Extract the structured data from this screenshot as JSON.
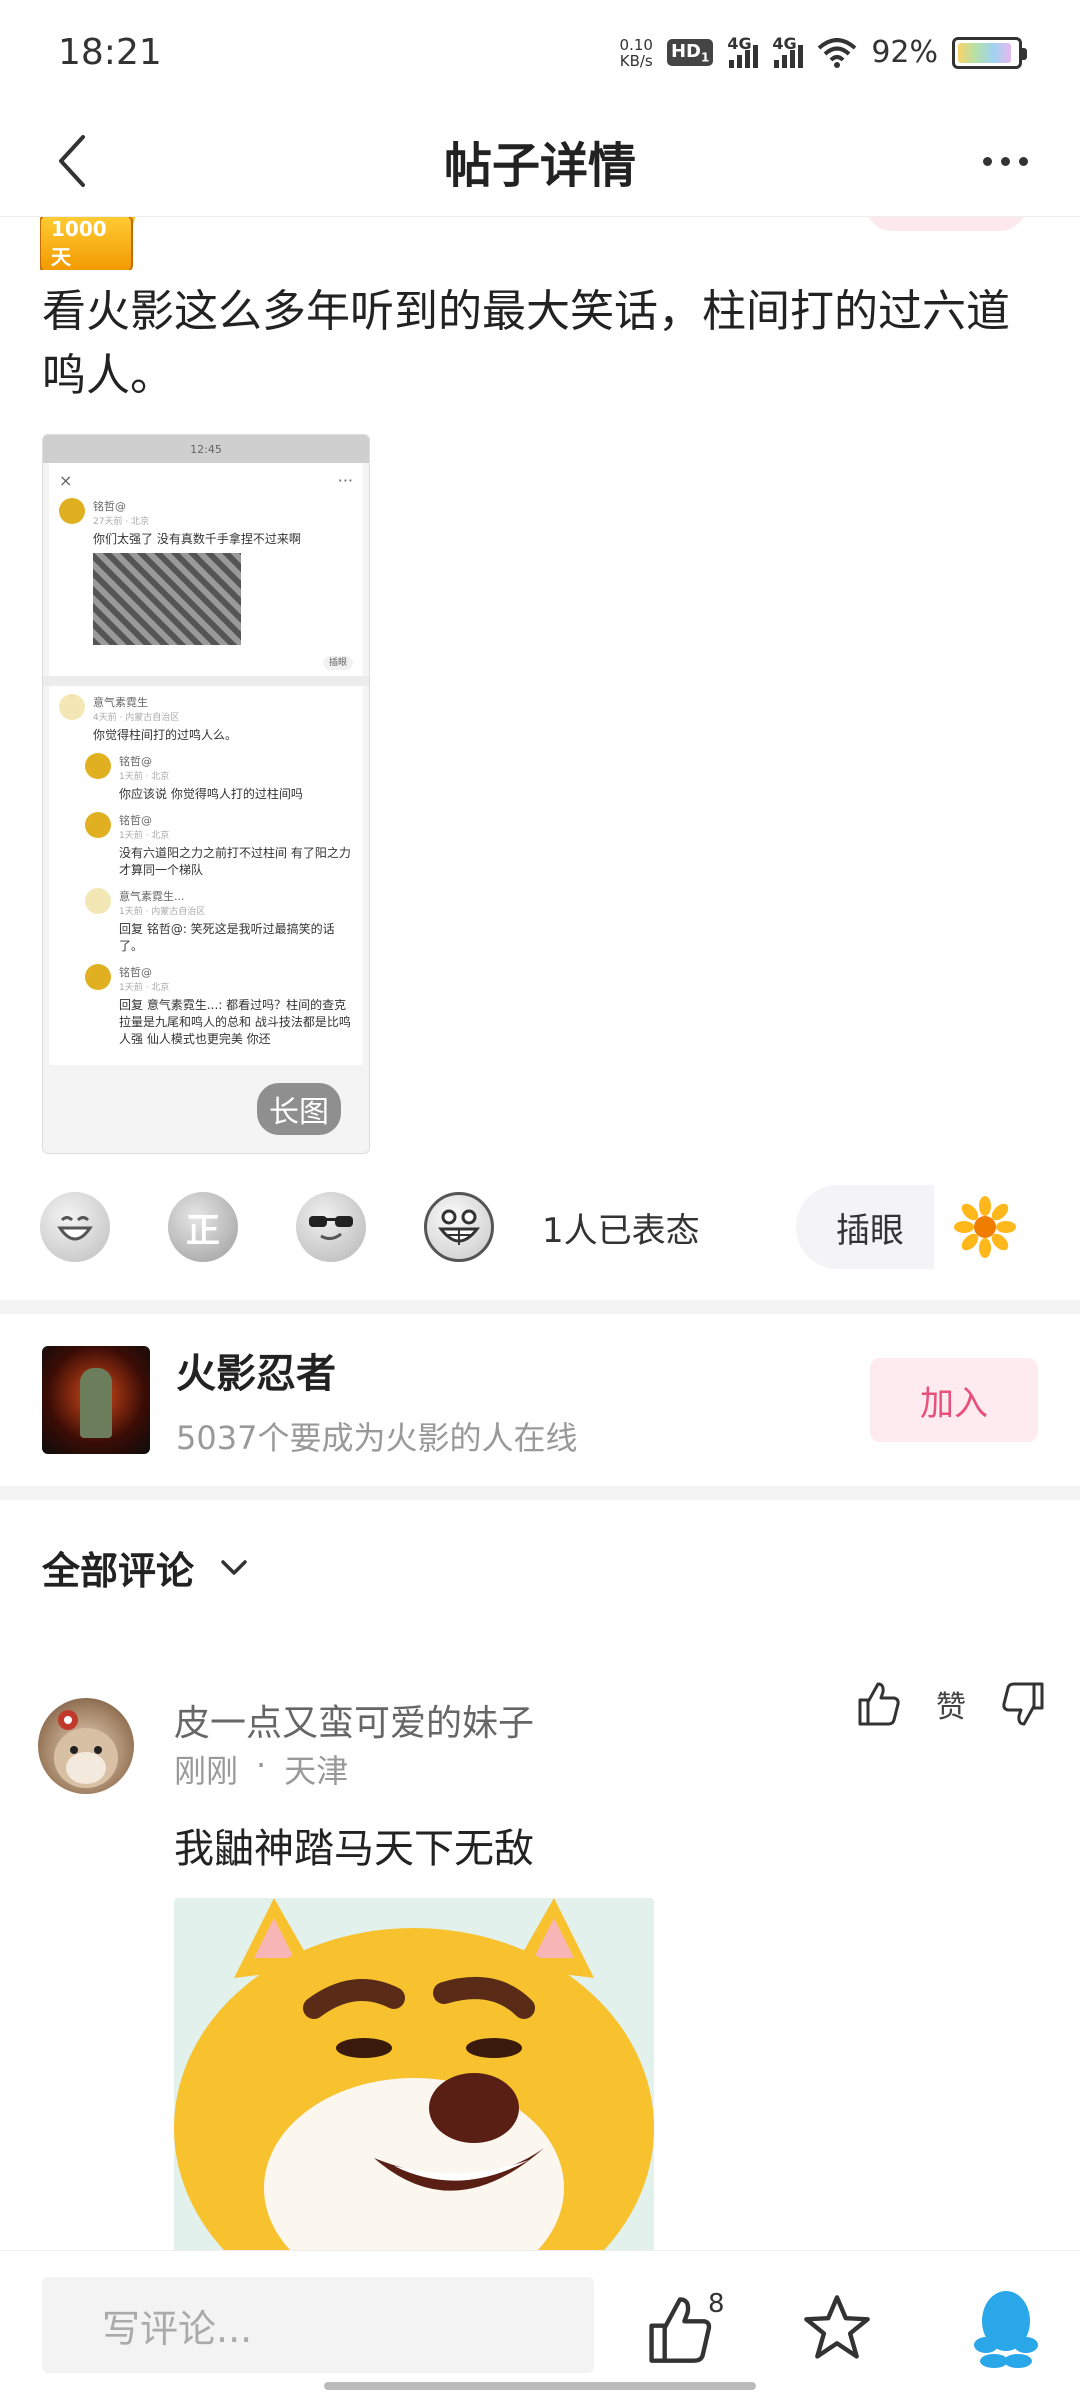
{
  "status_bar": {
    "time": "18:21",
    "net_speed_value": "0.10",
    "net_speed_unit": "KB/s",
    "hd": "HD",
    "hd_sub": "1",
    "sim1": "4G",
    "sim2": "4G",
    "battery_percent": "92%"
  },
  "nav": {
    "title": "帖子详情"
  },
  "author": {
    "badge": "1000天"
  },
  "post": {
    "text": "看火影这么多年听到的最大笑话，柱间打的过六道鸣人。",
    "long_image_tag": "长图",
    "screenshot": {
      "time": "12:45",
      "c1_name": "铭哲@",
      "c1_meta": "27天前 · 北京",
      "c1_text": "你们太强了 没有真数千手拿捏不过来啊",
      "c1_tag": "插眼",
      "c2_name": "意气素霓生",
      "c2_meta": "4天前 · 内蒙古自治区",
      "c2_text": "你觉得柱间打的过鸣人么。",
      "r1_name": "铭哲@",
      "r1_meta": "1天前 · 北京",
      "r1_text": "你应该说 你觉得鸣人打的过柱间吗",
      "r2_name": "铭哲@",
      "r2_meta": "1天前 · 北京",
      "r2_text": "没有六道阳之力之前打不过柱间 有了阳之力才算同一个梯队",
      "r3_name": "意气素霓生...",
      "r3_meta": "1天前 · 内蒙古自治区",
      "r3_text": "回复 铭哲@: 笑死这是我听过最搞笑的话了。",
      "r4_name": "铭哲@",
      "r4_meta": "1天前 · 北京",
      "r4_text": "回复 意气素霓生...: 都看过吗？柱间的查克拉量是九尾和鸣人的总和 战斗技法都是比鸣人强 仙人模式也更完美 你还"
    }
  },
  "reactions": {
    "zheng": "正",
    "count_text": "1人已表态",
    "pill_label": "插眼"
  },
  "group": {
    "name": "火影忍者",
    "online": "5037个要成为火影的人在线",
    "join_label": "加入"
  },
  "comments": {
    "header": "全部评论",
    "items": [
      {
        "name": "皮一点又蛮可爱的妹子",
        "time": "刚刚",
        "location": "天津",
        "like_label": "赞",
        "text": "我鼬神踏马天下无敌"
      }
    ]
  },
  "bottom_bar": {
    "placeholder": "写评论...",
    "like_count": "8"
  },
  "colors": {
    "accent_pink": "#e8507a",
    "qq_blue": "#2aa7e8"
  }
}
